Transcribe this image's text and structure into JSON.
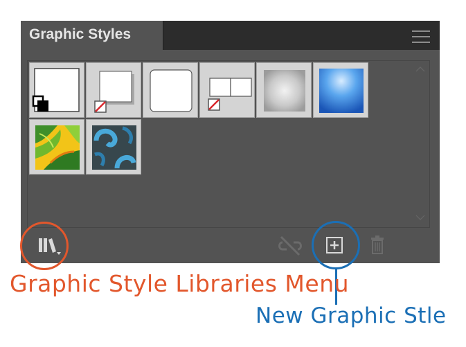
{
  "panel": {
    "title": "Graphic Styles",
    "menu_icon": "hamburger-menu-icon",
    "swatches": [
      {
        "name": "default-graphic-style",
        "icon": "default-style-swatch"
      },
      {
        "name": "default-style-drop-shadow",
        "icon": "shadow-square-swatch"
      },
      {
        "name": "rounded-corners",
        "icon": "rounded-square-swatch"
      },
      {
        "name": "double-box",
        "icon": "double-box-swatch"
      },
      {
        "name": "soft-bevel",
        "icon": "gray-bevel-swatch"
      },
      {
        "name": "blue-gradient",
        "icon": "blue-gradient-swatch"
      },
      {
        "name": "green-yellow-pattern",
        "icon": "green-yellow-texture-swatch"
      },
      {
        "name": "blue-swirl-pattern",
        "icon": "blue-swirl-texture-swatch"
      }
    ],
    "toolbar": {
      "libraries_icon": "graphic-style-libraries-icon",
      "break_link_icon": "break-link-icon",
      "new_style_icon": "new-graphic-style-icon",
      "delete_icon": "trash-icon"
    }
  },
  "annotations": {
    "libraries_label": "Graphic Style Libraries Menu",
    "new_style_label": "New Graphic Stle",
    "libraries_color": "#e2572c",
    "new_style_color": "#1b6fb5"
  },
  "colors": {
    "panel_bg": "#535353",
    "tabbar_bg": "#2c2c2c",
    "text": "#e6e6e6"
  }
}
